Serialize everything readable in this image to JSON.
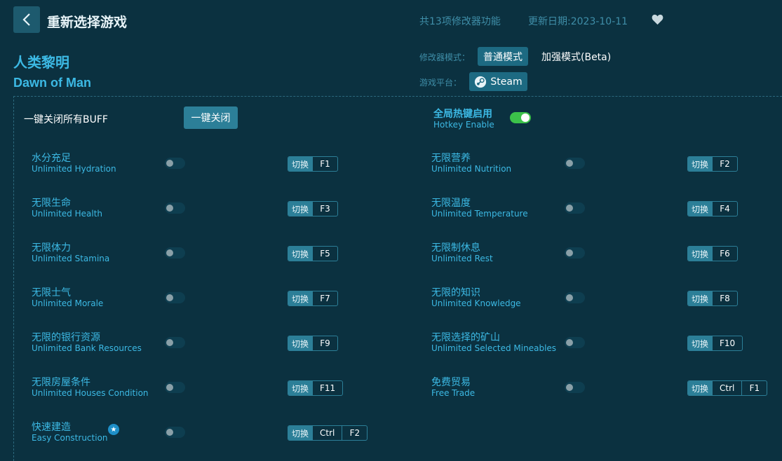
{
  "header": {
    "title": "重新选择游戏",
    "feature_count": "共13项修改器功能",
    "update_date": "更新日期:2023-10-11"
  },
  "game": {
    "name_cn": "人类黎明",
    "name_en": "Dawn of Man"
  },
  "mode": {
    "label": "修改器模式：",
    "options": [
      "普通模式",
      "加强模式(Beta)"
    ],
    "selected": "普通模式"
  },
  "platform": {
    "label": "游戏平台：",
    "value": "Steam"
  },
  "controls": {
    "close_all_label": "一键关闭所有BUFF",
    "close_all_button": "一键关闭",
    "hotkey_cn": "全局热键启用",
    "hotkey_en": "Hotkey Enable",
    "hotkey_enabled": true
  },
  "switch_label": "切换",
  "colors": {
    "background": "#0b3140",
    "accent": "#3cb9e4",
    "toggle_on": "#3cc24a",
    "button": "#2c7f98"
  },
  "cheats": [
    {
      "cn": "水分充足",
      "en": "Unlimited Hydration",
      "keys": [
        "F1"
      ],
      "enabled": false
    },
    {
      "cn": "无限营养",
      "en": "Unlimited Nutrition",
      "keys": [
        "F2"
      ],
      "enabled": false
    },
    {
      "cn": "无限生命",
      "en": "Unlimited Health",
      "keys": [
        "F3"
      ],
      "enabled": false
    },
    {
      "cn": "无限温度",
      "en": "Unlimited Temperature",
      "keys": [
        "F4"
      ],
      "enabled": false
    },
    {
      "cn": "无限体力",
      "en": "Unlimited Stamina",
      "keys": [
        "F5"
      ],
      "enabled": false
    },
    {
      "cn": "无限制休息",
      "en": "Unlimited Rest",
      "keys": [
        "F6"
      ],
      "enabled": false
    },
    {
      "cn": "无限士气",
      "en": "Unlimited Morale",
      "keys": [
        "F7"
      ],
      "enabled": false
    },
    {
      "cn": "无限的知识",
      "en": "Unlimited Knowledge",
      "keys": [
        "F8"
      ],
      "enabled": false
    },
    {
      "cn": "无限的银行资源",
      "en": "Unlimited Bank Resources",
      "keys": [
        "F9"
      ],
      "enabled": false
    },
    {
      "cn": "无限选择的矿山",
      "en": "Unlimited Selected Mineables",
      "keys": [
        "F10"
      ],
      "enabled": false
    },
    {
      "cn": "无限房屋条件",
      "en": "Unlimited Houses Condition",
      "keys": [
        "F11"
      ],
      "enabled": false
    },
    {
      "cn": "免费贸易",
      "en": "Free Trade",
      "keys": [
        "Ctrl",
        "F1"
      ],
      "enabled": false
    },
    {
      "cn": "快速建造",
      "en": "Easy Construction",
      "keys": [
        "Ctrl",
        "F2"
      ],
      "enabled": false,
      "starred": true
    }
  ]
}
